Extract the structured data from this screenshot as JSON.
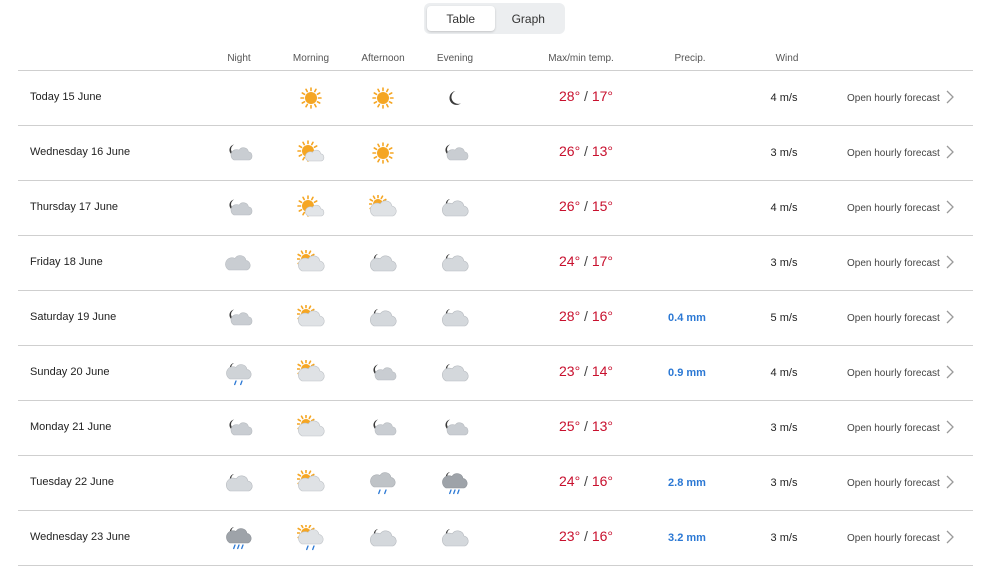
{
  "view_toggle": {
    "table_label": "Table",
    "graph_label": "Graph",
    "active": "table"
  },
  "columns": {
    "night": "Night",
    "morning": "Morning",
    "afternoon": "Afternoon",
    "evening": "Evening",
    "temp": "Max/min temp.",
    "precip": "Precip.",
    "wind": "Wind"
  },
  "colors": {
    "temp": "#c8102e",
    "precip": "#2b78d4",
    "sun": "#f5a623",
    "cloud": "#c9cdd2",
    "moon": "#3a3a3a",
    "rain": "#2b78d4"
  },
  "rows": [
    {
      "day": "Today 15 June",
      "night": "none",
      "morning": "sun-icon",
      "afternoon": "sun-icon",
      "evening": "moon-icon",
      "max": "28°",
      "min": "17°",
      "precip": "",
      "wind": "4 m/s",
      "link": "Open hourly forecast"
    },
    {
      "day": "Wednesday 16 June",
      "night": "moon-cloud-icon",
      "morning": "sun-small-cloud-icon",
      "afternoon": "sun-icon",
      "evening": "moon-cloud-icon",
      "max": "26°",
      "min": "13°",
      "precip": "",
      "wind": "3 m/s",
      "link": "Open hourly forecast"
    },
    {
      "day": "Thursday 17 June",
      "night": "moon-cloud-icon",
      "morning": "sun-small-cloud-icon",
      "afternoon": "sun-cloud-icon",
      "evening": "moon-big-cloud-icon",
      "max": "26°",
      "min": "15°",
      "precip": "",
      "wind": "4 m/s",
      "link": "Open hourly forecast"
    },
    {
      "day": "Friday 18 June",
      "night": "cloud-icon",
      "morning": "sun-cloud-icon",
      "afternoon": "moon-big-cloud-icon",
      "evening": "moon-big-cloud-icon",
      "max": "24°",
      "min": "17°",
      "precip": "",
      "wind": "3 m/s",
      "link": "Open hourly forecast"
    },
    {
      "day": "Saturday 19 June",
      "night": "moon-cloud-icon",
      "morning": "sun-cloud-icon",
      "afternoon": "moon-big-cloud-icon",
      "evening": "moon-big-cloud-icon",
      "max": "28°",
      "min": "16°",
      "precip": "0.4 mm",
      "wind": "5 m/s",
      "link": "Open hourly forecast"
    },
    {
      "day": "Sunday 20 June",
      "night": "moon-cloud-rain-icon",
      "morning": "sun-cloud-icon",
      "afternoon": "moon-cloud-icon",
      "evening": "moon-big-cloud-icon",
      "max": "23°",
      "min": "14°",
      "precip": "0.9 mm",
      "wind": "4 m/s",
      "link": "Open hourly forecast"
    },
    {
      "day": "Monday 21 June",
      "night": "moon-cloud-icon",
      "morning": "sun-cloud-icon",
      "afternoon": "moon-cloud-icon",
      "evening": "moon-cloud-icon",
      "max": "25°",
      "min": "13°",
      "precip": "",
      "wind": "3 m/s",
      "link": "Open hourly forecast"
    },
    {
      "day": "Tuesday 22 June",
      "night": "moon-big-cloud-icon",
      "morning": "sun-cloud-icon",
      "afternoon": "rain-cloud-icon",
      "evening": "moon-dark-cloud-rain-icon",
      "max": "24°",
      "min": "16°",
      "precip": "2.8 mm",
      "wind": "3 m/s",
      "link": "Open hourly forecast"
    },
    {
      "day": "Wednesday 23 June",
      "night": "moon-dark-cloud-rain-icon",
      "morning": "sun-cloud-rain-icon",
      "afternoon": "moon-big-cloud-icon",
      "evening": "moon-big-cloud-icon",
      "max": "23°",
      "min": "16°",
      "precip": "3.2 mm",
      "wind": "3 m/s",
      "link": "Open hourly forecast"
    }
  ]
}
